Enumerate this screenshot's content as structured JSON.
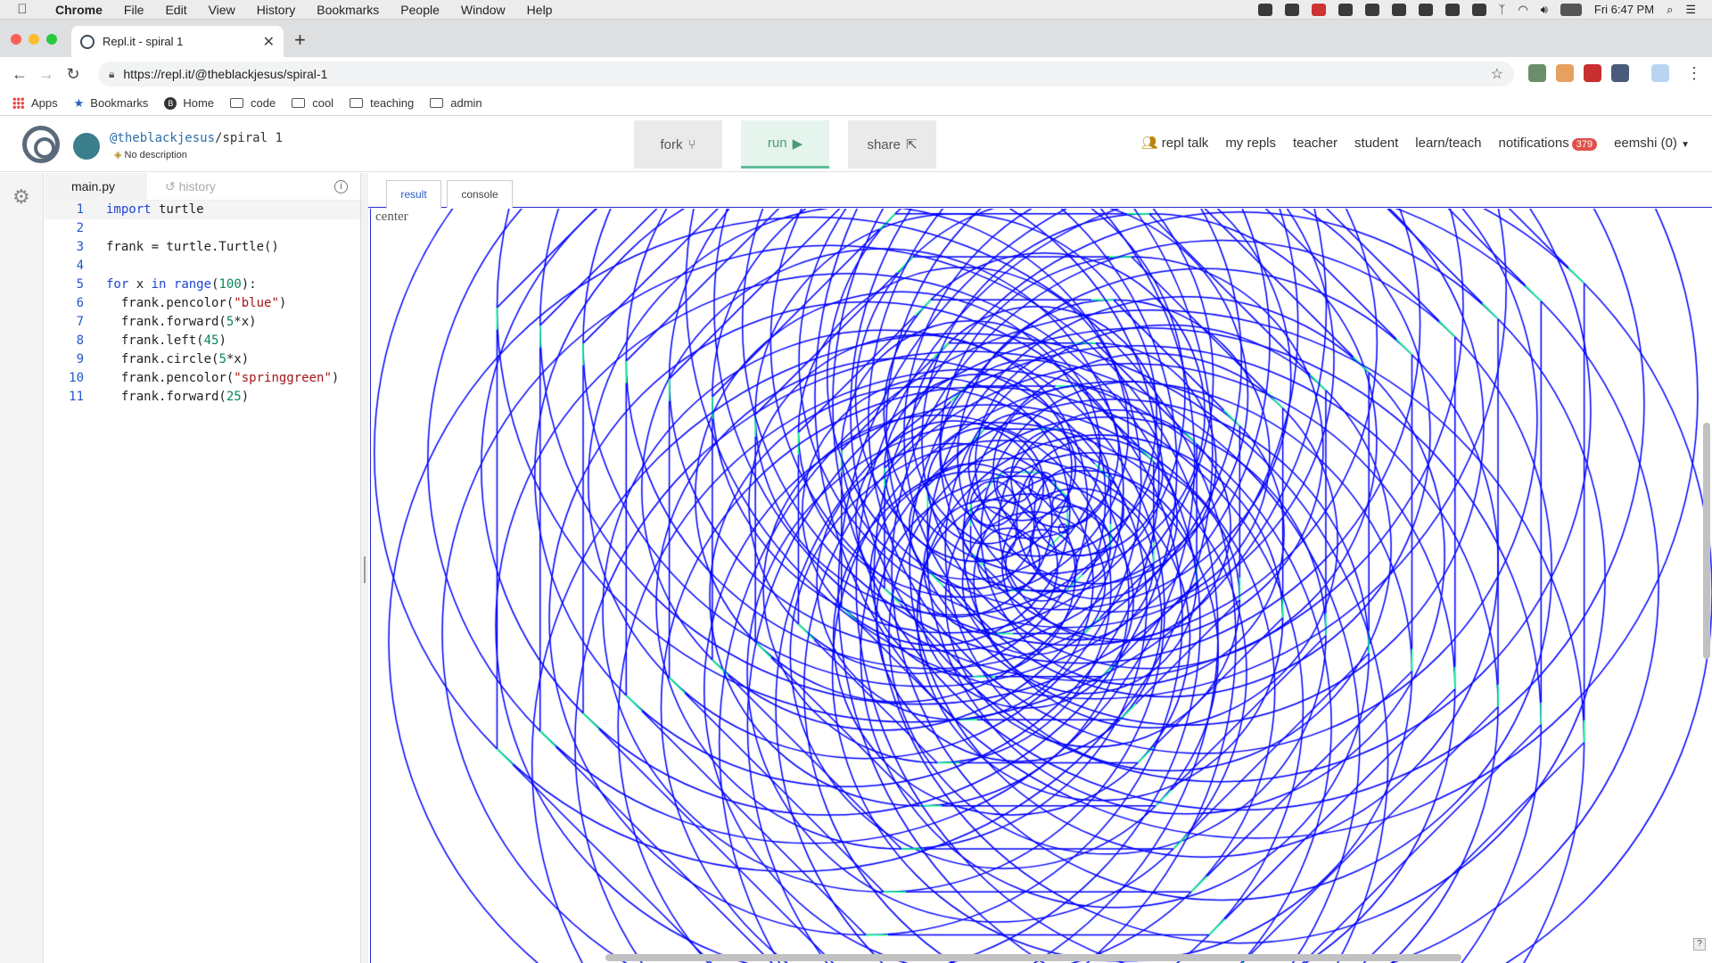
{
  "menubar": {
    "app": "Chrome",
    "items": [
      "File",
      "Edit",
      "View",
      "History",
      "Bookmarks",
      "People",
      "Window",
      "Help"
    ],
    "clock": "Fri 6:47 PM"
  },
  "browser": {
    "tab_title": "Repl.it - spiral 1",
    "url": "https://repl.it/@theblackjesus/spiral-1",
    "bookmarks": [
      {
        "label": "Apps",
        "icon": "apps-grid-icon"
      },
      {
        "label": "Bookmarks",
        "icon": "star-icon"
      },
      {
        "label": "Home",
        "icon": "b-badge-icon"
      },
      {
        "label": "code",
        "icon": "folder-icon"
      },
      {
        "label": "cool",
        "icon": "folder-icon"
      },
      {
        "label": "teaching",
        "icon": "folder-icon"
      },
      {
        "label": "admin",
        "icon": "folder-icon"
      }
    ]
  },
  "repl": {
    "user": "@theblackjesus",
    "slash": "/",
    "name": "spiral 1",
    "description": "No description",
    "buttons": {
      "fork": "fork",
      "run": "run",
      "share": "share"
    },
    "nav": {
      "repl_talk": "repl talk",
      "my_repls": "my repls",
      "teacher": "teacher",
      "student": "student",
      "learn_teach": "learn/teach",
      "notifications": "notifications",
      "notifications_count": "379",
      "account": "eemshi (0)"
    }
  },
  "editor": {
    "file_tab": "main.py",
    "history_tab": "history",
    "lines": [
      {
        "n": "1",
        "html": "<span class=\"kw\">import</span> turtle"
      },
      {
        "n": "2",
        "html": ""
      },
      {
        "n": "3",
        "html": "frank = turtle.Turtle()"
      },
      {
        "n": "4",
        "html": ""
      },
      {
        "n": "5",
        "html": "<span class=\"kw\">for</span> x <span class=\"kw\">in</span> <span class=\"kw\">range</span>(<span class=\"num\">100</span>):"
      },
      {
        "n": "6",
        "html": "  frank.pencolor(<span class=\"str\">\"blue\"</span>)"
      },
      {
        "n": "7",
        "html": "  frank.forward(<span class=\"num\">5</span>*x)"
      },
      {
        "n": "8",
        "html": "  frank.left(<span class=\"num\">45</span>)"
      },
      {
        "n": "9",
        "html": "  frank.circle(<span class=\"num\">5</span>*x)"
      },
      {
        "n": "10",
        "html": "  frank.pencolor(<span class=\"str\">\"springgreen\"</span>)"
      },
      {
        "n": "11",
        "html": "  frank.forward(<span class=\"num\">25</span>)"
      }
    ]
  },
  "output": {
    "tabs": {
      "result": "result",
      "console": "console"
    },
    "canvas_label": "center",
    "drawing": {
      "iterations": 100,
      "circle_color": "#0000ff",
      "step_color": "#00ff7f",
      "turn_deg": 45,
      "step_len": 25,
      "radius_factor": 5
    }
  },
  "colors": {
    "accent_run": "#5fbf9a",
    "badge": "#e0514b",
    "link": "#2d6ea8"
  }
}
